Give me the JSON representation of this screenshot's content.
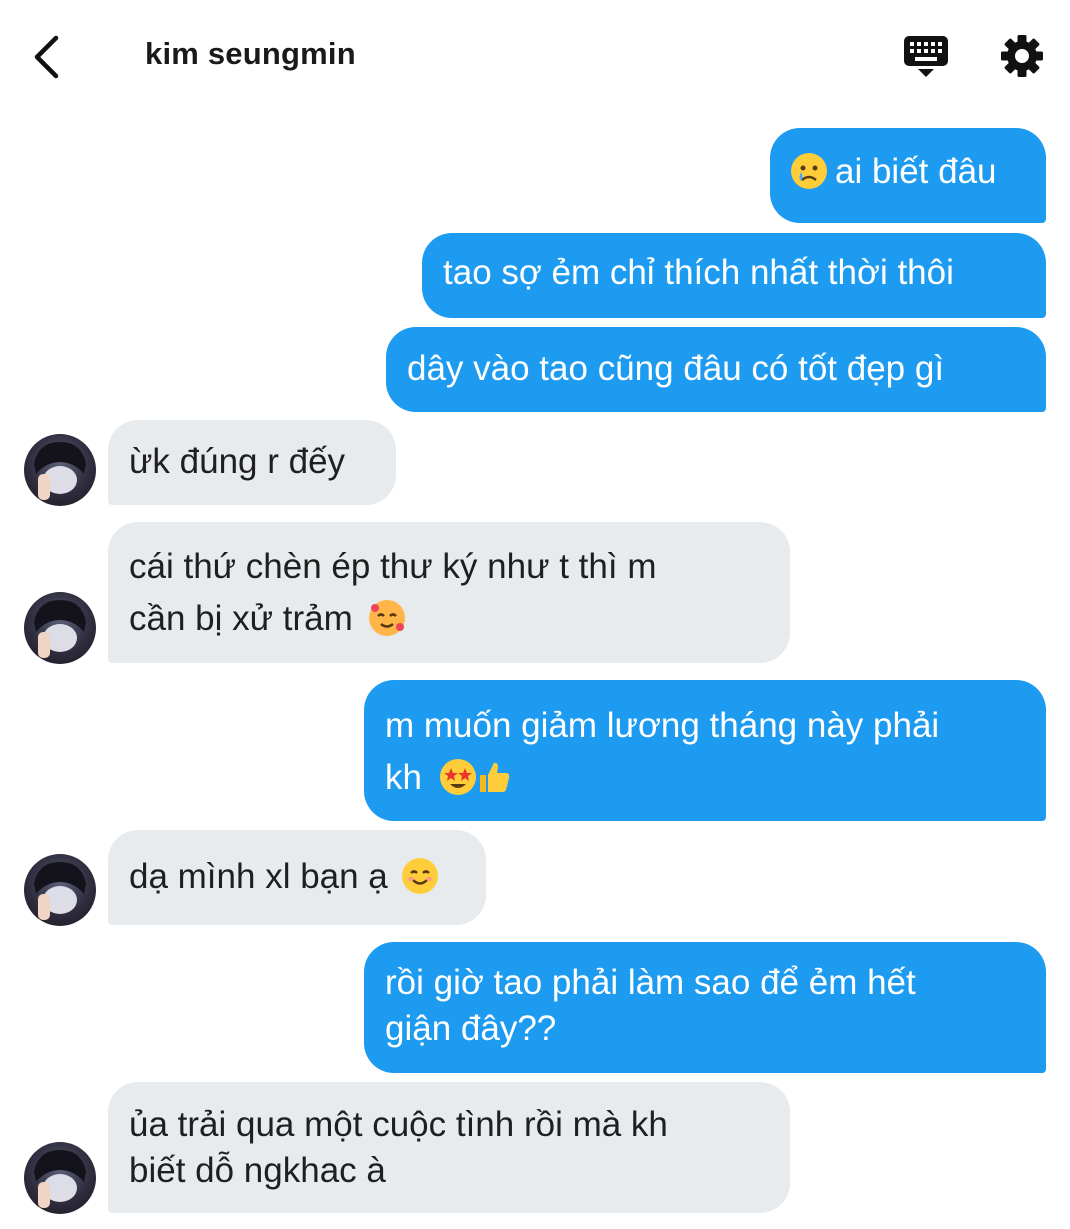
{
  "header": {
    "title": "kim seungmin"
  },
  "messages": [
    {
      "side": "out",
      "text": "ai biết đâu",
      "emoji_before": "crying-face"
    },
    {
      "side": "out",
      "text": "tao sợ ẻm chỉ thích nhất thời thôi"
    },
    {
      "side": "out",
      "text": "dây vào tao cũng đâu có tốt đẹp gì"
    },
    {
      "side": "in",
      "text": "ừk đúng r đếy"
    },
    {
      "side": "in",
      "line1": "cái thứ chèn ép thư ký như t thì m",
      "line2": "cần bị xử trảm",
      "emoji_after": "smiling-face-with-hearts"
    },
    {
      "side": "out",
      "line1": "m muốn giảm lương tháng này phải",
      "line2": "kh",
      "emoji_after": [
        "star-struck",
        "thumbs-up"
      ]
    },
    {
      "side": "in",
      "text": "dạ mình xl bạn ạ",
      "emoji_after": "smiling-face"
    },
    {
      "side": "out",
      "line1": "rồi giờ tao phải làm sao để ẻm hết",
      "line2": "giận đây??"
    },
    {
      "side": "in",
      "line1": "ủa trải qua một cuộc tình rồi mà kh",
      "line2": "biết dỗ ngkhac à"
    }
  ],
  "colors": {
    "outgoing_bubble": "#1d9bf0",
    "incoming_bubble": "#e8ebee"
  }
}
